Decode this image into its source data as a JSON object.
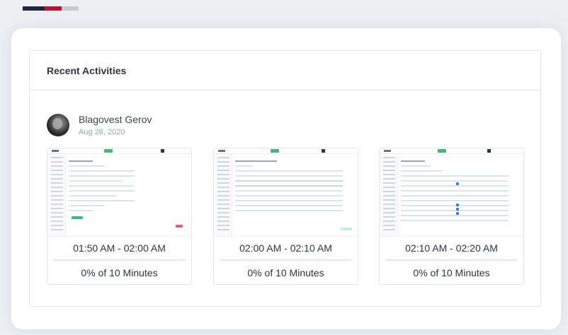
{
  "brand_strip": {
    "colors": [
      "#1f2340",
      "#1f2340",
      "#b8122f",
      "#c6cad3"
    ]
  },
  "activities": {
    "title": "Recent Activities",
    "user": {
      "name": "Blagovest Gerov",
      "date": "Aug 26, 2020"
    },
    "screenshots": [
      {
        "thumbnail_title": "Add Invoice",
        "time_range": "01:50 AM - 02:00 AM",
        "activity_text": "0% of 10 Minutes",
        "activity_fraction": 0
      },
      {
        "thumbnail_title": "Register Proposal",
        "time_range": "02:00 AM - 02:10 AM",
        "activity_text": "0% of 10 Minutes",
        "activity_fraction": 0
      },
      {
        "thumbnail_title": "Settings",
        "time_range": "02:10 AM - 02:20 AM",
        "activity_text": "0% of 10 Minutes",
        "activity_fraction": 0
      }
    ]
  }
}
